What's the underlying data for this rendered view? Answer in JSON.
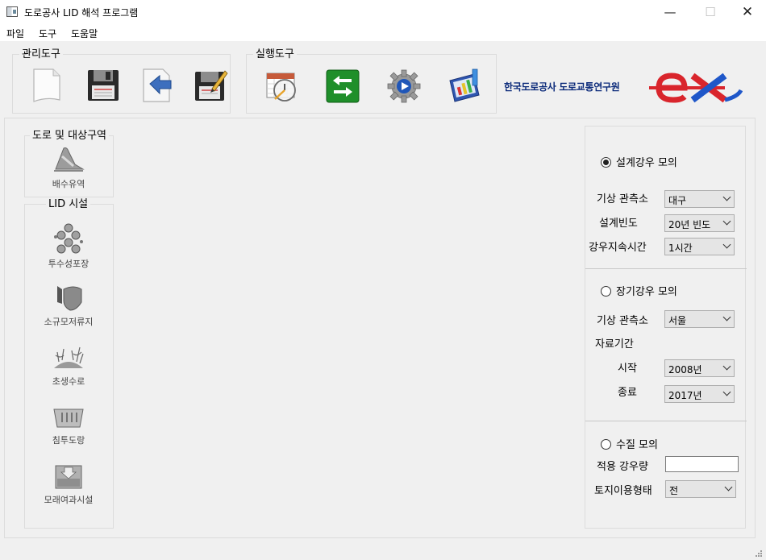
{
  "window": {
    "title": "도로공사 LID 해석 프로그램",
    "minimize": "—",
    "maximize": "☐",
    "close": "✕"
  },
  "menu": [
    "파일",
    "도구",
    "도움말"
  ],
  "toolbar": {
    "manage_title": "관리도구",
    "manage_tools": [
      "new-file-icon",
      "save-floppy-icon",
      "import-arrow-icon",
      "save-as-floppy-icon"
    ],
    "run_title": "실행도구",
    "run_tools": [
      "calendar-clock-icon",
      "swap-arrows-icon",
      "gear-run-icon",
      "chart-report-icon"
    ],
    "org_name": "한국도로공사 도로교통연구원",
    "logo_text": "ex",
    "colors": {
      "logo_red": "#d9252c",
      "logo_blue": "#1f57c9",
      "org_text": "#0b2a7a"
    }
  },
  "left_panel": {
    "road_title": "도로 및 대상구역",
    "drainage_label": "배수유역",
    "lid_title": "LID 시설",
    "lid_items": [
      "투수성포장",
      "소규모저류지",
      "초생수로",
      "침투도랑",
      "모래여과시설"
    ]
  },
  "design_rain": {
    "radio_label": "설계강우 모의",
    "selected": true,
    "station_label": "기상 관측소",
    "station_value": "대구",
    "freq_label": "설계빈도",
    "freq_value": "20년 빈도",
    "duration_label": "강우지속시간",
    "duration_value": "1시간"
  },
  "long_rain": {
    "radio_label": "장기강우 모의",
    "selected": false,
    "station_label": "기상 관측소",
    "station_value": "서울",
    "period_label": "자료기간",
    "start_label": "시작",
    "start_value": "2008년",
    "end_label": "종료",
    "end_value": "2017년"
  },
  "water_quality": {
    "radio_label": "수질 모의",
    "selected": false,
    "rain_label": "적용 강우량",
    "rain_value": "",
    "landuse_label": "토지이용형태",
    "landuse_value": "전"
  }
}
